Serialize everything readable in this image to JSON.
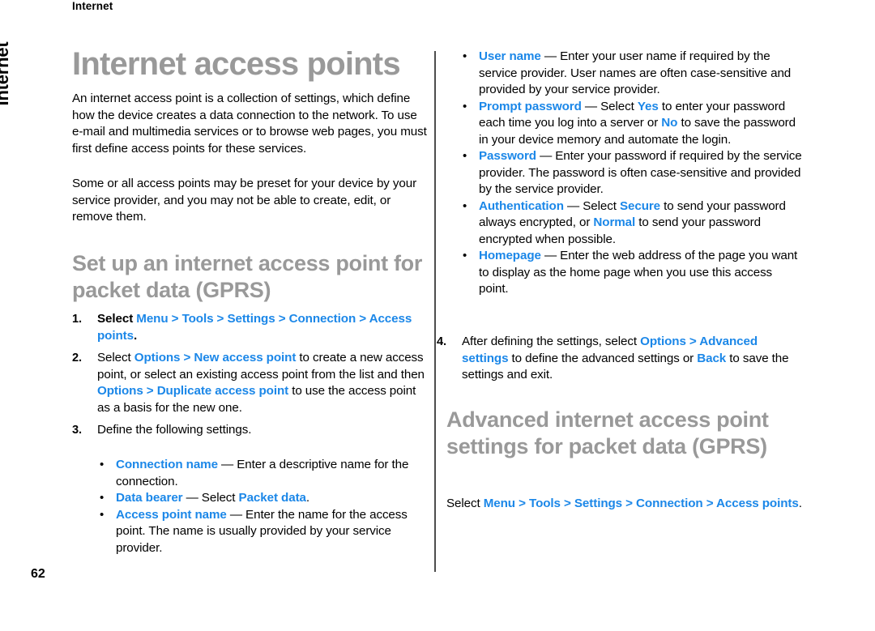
{
  "page": {
    "running_header": "Internet",
    "side_tab": "Internet",
    "folio": "62",
    "accent_color": "#1b87e8",
    "heading_color": "#999999",
    "divider_color": "#4d4d4d"
  },
  "left_column": {
    "title": "Internet access points",
    "intro_paragraphs": [
      "An internet access point is a collection of settings, which define how the device creates a data connection to the network. To use e-mail and multimedia services or to browse web pages, you must first define access points for these services.",
      "Some or all access points may be preset for your device by your service provider, and you may not be able to create, edit, or remove them."
    ],
    "subtitle": "Set up an internet access point for packet data (GPRS)",
    "steps": [
      {
        "marker": "1.",
        "parts": [
          {
            "t": "Select ",
            "s": "plain"
          },
          {
            "t": "Menu",
            "s": "ui"
          },
          {
            "t": " > ",
            "s": "gt"
          },
          {
            "t": "Tools",
            "s": "ui"
          },
          {
            "t": " > ",
            "s": "gt"
          },
          {
            "t": "Settings",
            "s": "ui"
          },
          {
            "t": " > ",
            "s": "gt"
          },
          {
            "t": "Connection",
            "s": "ui"
          },
          {
            "t": " > ",
            "s": "gt"
          },
          {
            "t": "Access points",
            "s": "ui"
          },
          {
            "t": ".",
            "s": "plain"
          }
        ]
      },
      {
        "marker": "2.",
        "parts": [
          {
            "t": "Select ",
            "s": "plain"
          },
          {
            "t": "Options",
            "s": "ui"
          },
          {
            "t": " > ",
            "s": "gt"
          },
          {
            "t": "New access point",
            "s": "ui"
          },
          {
            "t": " to create a new access point, or select an existing access point from the list and then ",
            "s": "plain"
          },
          {
            "t": "Options",
            "s": "ui"
          },
          {
            "t": " > ",
            "s": "gt"
          },
          {
            "t": "Duplicate access point",
            "s": "ui"
          },
          {
            "t": " to use the access point as a basis for the new one.",
            "s": "plain"
          }
        ]
      },
      {
        "marker": "3.",
        "parts": [
          {
            "t": "Define the following settings.",
            "s": "plain"
          }
        ]
      }
    ],
    "bullets": [
      {
        "parts": [
          {
            "t": "Connection name",
            "s": "ui"
          },
          {
            "t": " — Enter a descriptive name for the connection.",
            "s": "plain"
          }
        ]
      },
      {
        "parts": [
          {
            "t": "Data bearer",
            "s": "ui"
          },
          {
            "t": " — Select ",
            "s": "plain"
          },
          {
            "t": "Packet data",
            "s": "ui"
          },
          {
            "t": ".",
            "s": "plain"
          }
        ]
      },
      {
        "parts": [
          {
            "t": "Access point name",
            "s": "ui"
          },
          {
            "t": " — Enter the name for the access point. The name is usually provided by your service provider.",
            "s": "plain"
          }
        ]
      }
    ]
  },
  "right_column": {
    "bullets": [
      {
        "parts": [
          {
            "t": "User name",
            "s": "ui"
          },
          {
            "t": " — Enter your user name if required by the service provider. User names are often case-sensitive and provided by your service provider.",
            "s": "plain"
          }
        ]
      },
      {
        "parts": [
          {
            "t": "Prompt password",
            "s": "ui"
          },
          {
            "t": " — Select ",
            "s": "plain"
          },
          {
            "t": "Yes",
            "s": "ui"
          },
          {
            "t": " to enter your password each time you log into a server or ",
            "s": "plain"
          },
          {
            "t": "No",
            "s": "ui"
          },
          {
            "t": " to save the password in your device memory and automate the login.",
            "s": "plain"
          }
        ]
      },
      {
        "parts": [
          {
            "t": "Password",
            "s": "ui"
          },
          {
            "t": " — Enter your password if required by the service provider. The password is often case-sensitive and provided by the service provider.",
            "s": "plain"
          }
        ]
      },
      {
        "parts": [
          {
            "t": "Authentication",
            "s": "ui"
          },
          {
            "t": " — Select ",
            "s": "plain"
          },
          {
            "t": "Secure",
            "s": "ui"
          },
          {
            "t": " to send your password always encrypted, or ",
            "s": "plain"
          },
          {
            "t": "Normal",
            "s": "ui"
          },
          {
            "t": " to send your password encrypted when possible.",
            "s": "plain"
          }
        ]
      },
      {
        "parts": [
          {
            "t": "Homepage",
            "s": "ui"
          },
          {
            "t": " — Enter the web address of the page you want to display as the home page when you use this access point.",
            "s": "plain"
          }
        ]
      }
    ],
    "steps": [
      {
        "marker": "4.",
        "parts": [
          {
            "t": "After defining the settings, select ",
            "s": "plain"
          },
          {
            "t": "Options",
            "s": "ui"
          },
          {
            "t": " > ",
            "s": "gt"
          },
          {
            "t": "Advanced settings",
            "s": "ui"
          },
          {
            "t": " to define the advanced settings or ",
            "s": "plain"
          },
          {
            "t": "Back",
            "s": "ui"
          },
          {
            "t": " to save the settings and exit.",
            "s": "plain"
          }
        ]
      }
    ],
    "subtitle": "Advanced internet access point settings for packet data (GPRS)",
    "closing_parts": [
      {
        "t": "Select ",
        "s": "plain"
      },
      {
        "t": "Menu",
        "s": "ui"
      },
      {
        "t": " > ",
        "s": "gt"
      },
      {
        "t": "Tools",
        "s": "ui"
      },
      {
        "t": " > ",
        "s": "gt"
      },
      {
        "t": "Settings",
        "s": "ui"
      },
      {
        "t": " > ",
        "s": "gt"
      },
      {
        "t": "Connection",
        "s": "ui"
      },
      {
        "t": " > ",
        "s": "gt"
      },
      {
        "t": "Access points",
        "s": "ui"
      },
      {
        "t": ".",
        "s": "plain"
      }
    ]
  }
}
